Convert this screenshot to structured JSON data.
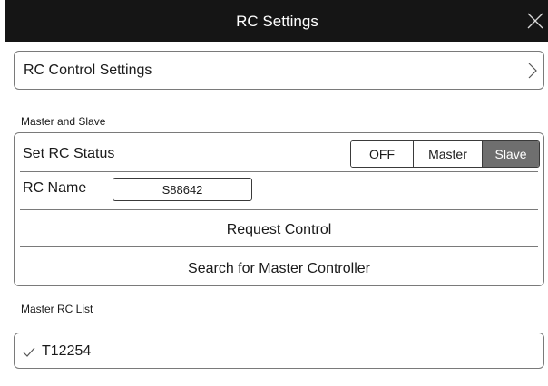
{
  "window": {
    "title": "RC Settings",
    "close_icon": "close-icon"
  },
  "control_settings": {
    "label": "RC Control Settings",
    "chevron_icon": "chevron-right-icon"
  },
  "master_slave": {
    "section_label": "Master and Slave",
    "status": {
      "label": "Set RC Status",
      "options": [
        "OFF",
        "Master",
        "Slave"
      ],
      "selected": "Slave",
      "selected_color": "#6f6f6f"
    },
    "name": {
      "label": "RC Name",
      "value": "S88642"
    },
    "request_control_label": "Request Control",
    "search_master_label": "Search for Master Controller"
  },
  "master_list": {
    "section_label": "Master RC List",
    "items": [
      {
        "label": "T12254",
        "checked": true,
        "icon": "check-icon"
      }
    ]
  },
  "colors": {
    "titlebar": "#151515",
    "border": "#7a7a7a"
  }
}
